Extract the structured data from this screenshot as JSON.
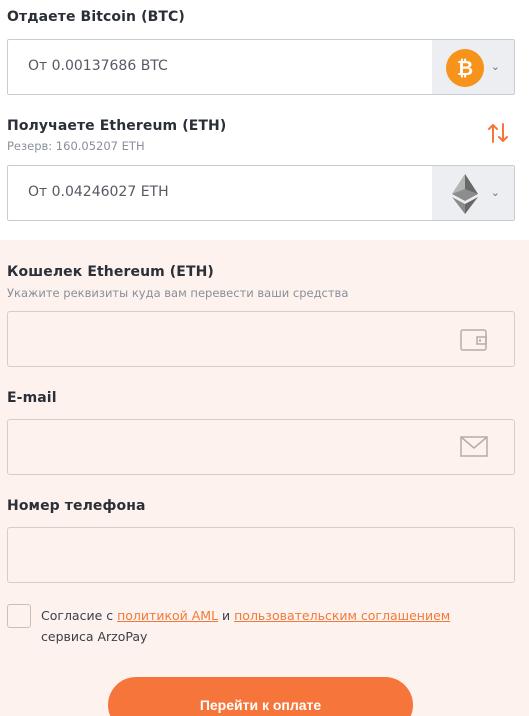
{
  "give": {
    "label": "Отдаете Bitcoin (BTC)",
    "amount_placeholder": "От 0.00137686 BTC",
    "coin_icon": "bitcoin-icon"
  },
  "receive": {
    "label": "Получаете Ethereum (ETH)",
    "reserve": "Резерв: 160.05207 ETH",
    "amount_placeholder": "От 0.04246027 ETH",
    "coin_icon": "ethereum-icon"
  },
  "wallet": {
    "label": "Кошелек Ethereum (ETH)",
    "hint": "Укажите реквизиты куда вам перевести ваши средства",
    "value": ""
  },
  "email": {
    "label": "E-mail",
    "value": ""
  },
  "phone": {
    "label": "Номер телефона",
    "value": ""
  },
  "consent": {
    "prefix": "Согласие с ",
    "aml_link": "политикой AML",
    "middle": " и ",
    "terms_link": "пользовательским соглашением",
    "suffix": "сервиса ArzoPay"
  },
  "submit_label": "Перейти к оплате",
  "colors": {
    "accent": "#f5753a",
    "bitcoin": "#f7931a",
    "form_bg": "#fdf2ee"
  }
}
